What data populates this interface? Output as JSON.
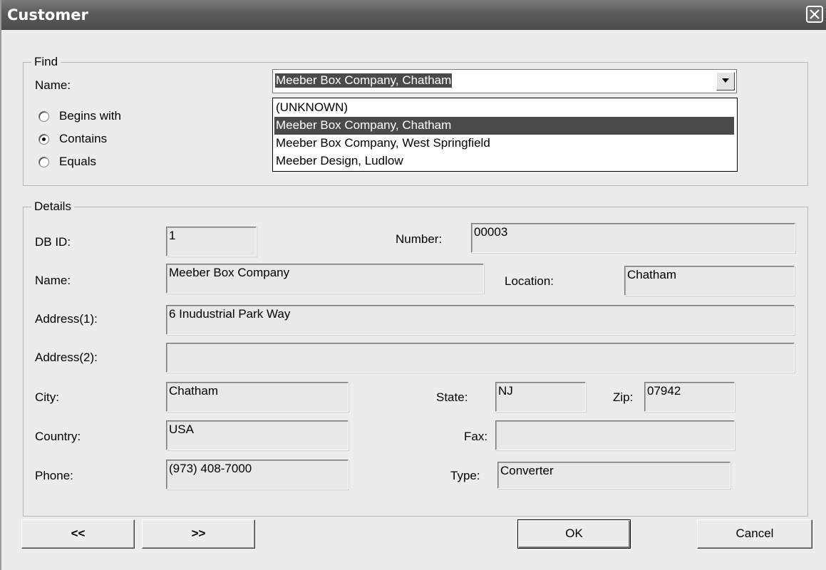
{
  "window": {
    "title": "Customer"
  },
  "find": {
    "legend": "Find",
    "name_label": "Name:",
    "selected_value": "Meeber Box Company, Chatham",
    "options": [
      "(UNKNOWN)",
      "Meeber Box Company, Chatham",
      "Meeber Box Company, West Springfield",
      "Meeber Design, Ludlow"
    ],
    "highlighted_index": 1,
    "match_modes": [
      "Begins with",
      "Contains",
      "Equals"
    ],
    "selected_mode": "Contains"
  },
  "details": {
    "legend": "Details",
    "db_id_label": "DB ID:",
    "db_id": "1",
    "number_label": "Number:",
    "number": "00003",
    "name_label": "Name:",
    "name": "Meeber Box Company",
    "location_label": "Location:",
    "location": "Chatham",
    "address1_label": "Address(1):",
    "address1": "6 Inudustrial Park Way",
    "address2_label": "Address(2):",
    "address2": "",
    "city_label": "City:",
    "city": "Chatham",
    "state_label": "State:",
    "state": "NJ",
    "zip_label": "Zip:",
    "zip": "07942",
    "country_label": "Country:",
    "country": "USA",
    "fax_label": "Fax:",
    "fax": "",
    "phone_label": "Phone:",
    "phone": "(973) 408-7000",
    "type_label": "Type:",
    "type": "Converter"
  },
  "buttons": {
    "prev": "<<",
    "next": ">>",
    "ok": "OK",
    "cancel": "Cancel"
  }
}
